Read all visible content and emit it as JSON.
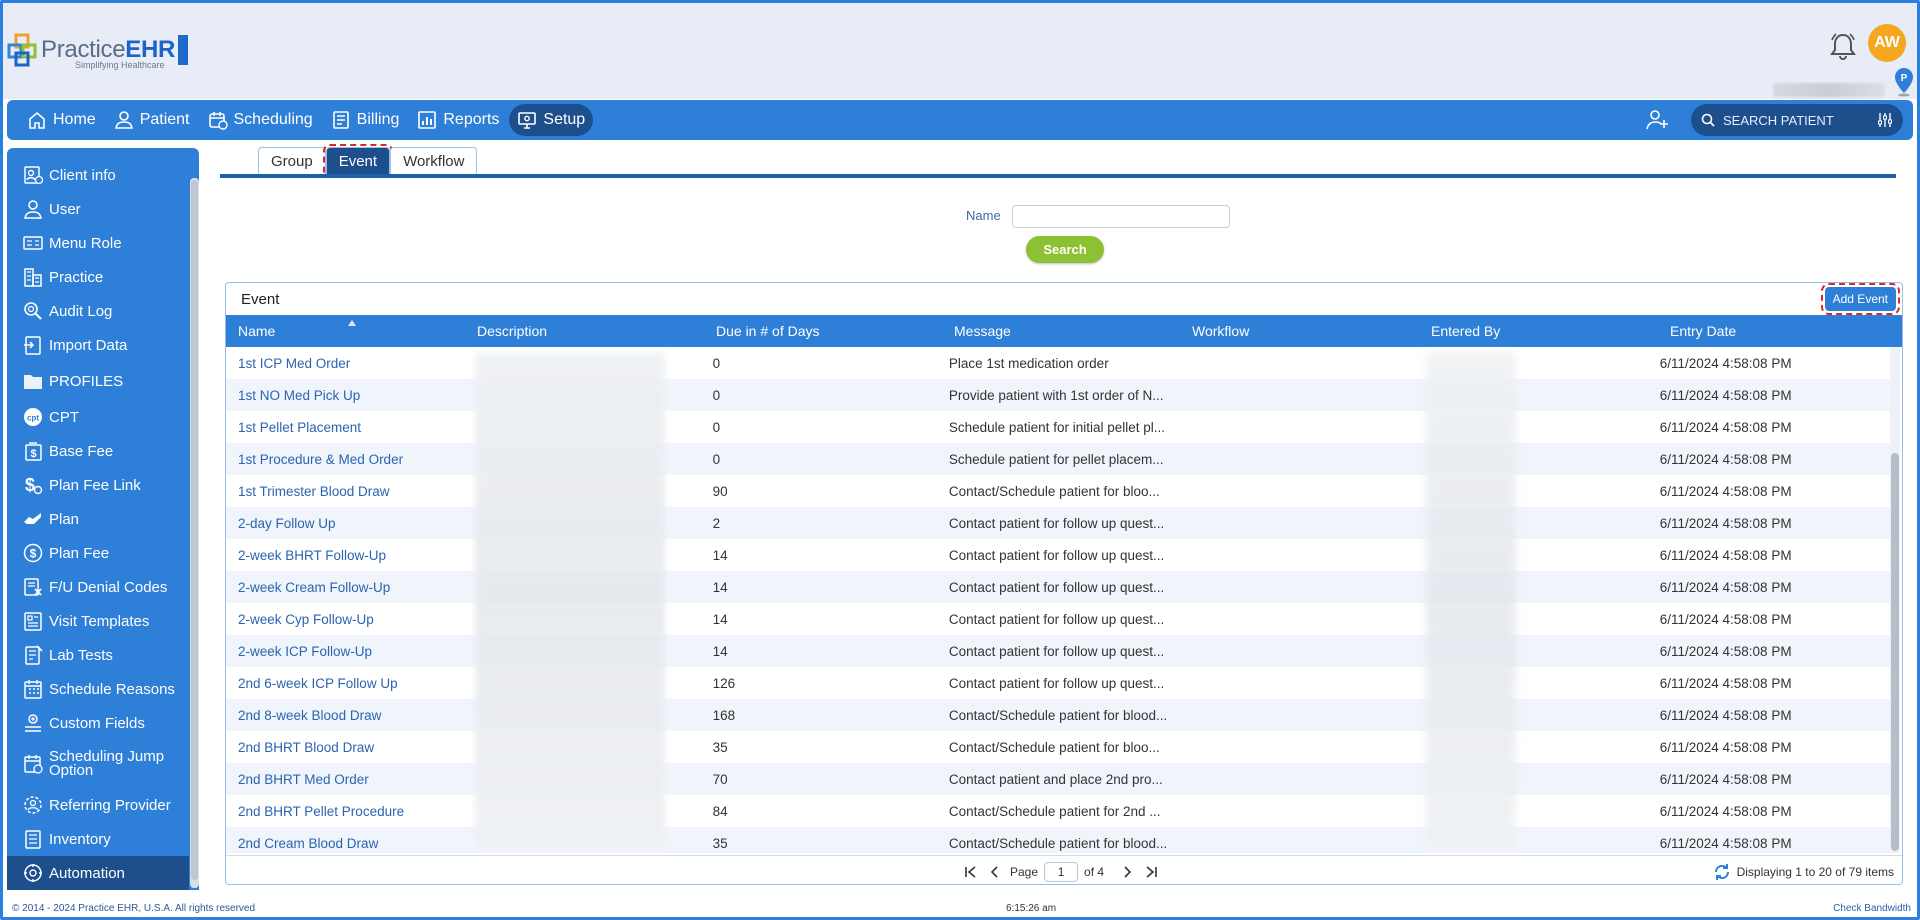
{
  "app": {
    "brand_light": "Practice",
    "brand_bold": "EHR",
    "tagline": "Simplifying Healthcare",
    "user_initials": "AW",
    "brand_color": "#2e7fd8",
    "accent_dark": "#1d4f8d",
    "avatar_color": "#f4a71f"
  },
  "nav": {
    "items": [
      {
        "label": "Home",
        "icon": "home-icon"
      },
      {
        "label": "Patient",
        "icon": "user-icon"
      },
      {
        "label": "Scheduling",
        "icon": "calendar-icon"
      },
      {
        "label": "Billing",
        "icon": "invoice-icon"
      },
      {
        "label": "Reports",
        "icon": "report-icon"
      },
      {
        "label": "Setup",
        "icon": "monitor-gear-icon",
        "active": true
      }
    ],
    "search_placeholder": "SEARCH PATIENT"
  },
  "sidebar": {
    "items": [
      {
        "label": "Client info",
        "icon": "client-info-icon"
      },
      {
        "label": "User",
        "icon": "user-icon"
      },
      {
        "label": "Menu Role",
        "icon": "menu-role-icon"
      },
      {
        "label": "Practice",
        "icon": "building-icon"
      },
      {
        "label": "Audit Log",
        "icon": "magnifier-icon"
      },
      {
        "label": "Import Data",
        "icon": "import-icon"
      },
      {
        "label": "PROFILES",
        "icon": "folder-icon",
        "section": true
      },
      {
        "label": "CPT",
        "icon": "cpt-icon"
      },
      {
        "label": "Base Fee",
        "icon": "dollar-doc-icon"
      },
      {
        "label": "Plan Fee Link",
        "icon": "dollar-link-icon"
      },
      {
        "label": "Plan",
        "icon": "hand-icon"
      },
      {
        "label": "Plan Fee",
        "icon": "dollar-circle-icon"
      },
      {
        "label": "F/U Denial Codes",
        "icon": "denial-icon"
      },
      {
        "label": "Visit Templates",
        "icon": "template-icon"
      },
      {
        "label": "Lab Tests",
        "icon": "lab-icon"
      },
      {
        "label": "Schedule Reasons",
        "icon": "calendar-grid-icon"
      },
      {
        "label": "Custom Fields",
        "icon": "custom-fields-icon"
      },
      {
        "label": "Scheduling Jump Option",
        "icon": "calendar-jump-icon",
        "tall": true
      },
      {
        "label": "Referring Provider",
        "icon": "gear-person-icon"
      },
      {
        "label": "Inventory",
        "icon": "inventory-icon"
      },
      {
        "label": "Automation",
        "icon": "automation-icon",
        "active": true
      }
    ]
  },
  "tabs": [
    {
      "label": "Group"
    },
    {
      "label": "Event",
      "active": true
    },
    {
      "label": "Workflow"
    }
  ],
  "filter": {
    "name_label": "Name",
    "name_value": "",
    "search_label": "Search"
  },
  "grid": {
    "title": "Event",
    "add_label": "Add Event",
    "columns": [
      "Name",
      "Description",
      "Due in # of Days",
      "Message",
      "Workflow",
      "Entered By",
      "Entry Date"
    ],
    "rows": [
      {
        "name": "1st ICP Med Order",
        "due": "0",
        "message": "Place 1st medication order",
        "date": "6/11/2024 4:58:08 PM"
      },
      {
        "name": "1st NO Med Pick Up",
        "due": "0",
        "message": "Provide patient with 1st order of N...",
        "date": "6/11/2024 4:58:08 PM"
      },
      {
        "name": "1st Pellet Placement",
        "due": "0",
        "message": "Schedule patient for initial pellet pl...",
        "date": "6/11/2024 4:58:08 PM"
      },
      {
        "name": "1st Procedure & Med Order",
        "due": "0",
        "message": "Schedule patient for pellet placem...",
        "date": "6/11/2024 4:58:08 PM"
      },
      {
        "name": "1st Trimester Blood Draw",
        "due": "90",
        "message": "Contact/Schedule patient for bloo...",
        "date": "6/11/2024 4:58:08 PM"
      },
      {
        "name": "2-day Follow Up",
        "due": "2",
        "message": "Contact patient for follow up quest...",
        "date": "6/11/2024 4:58:08 PM"
      },
      {
        "name": "2-week BHRT Follow-Up",
        "due": "14",
        "message": "Contact patient for follow up quest...",
        "date": "6/11/2024 4:58:08 PM"
      },
      {
        "name": "2-week Cream Follow-Up",
        "due": "14",
        "message": "Contact patient for follow up quest...",
        "date": "6/11/2024 4:58:08 PM"
      },
      {
        "name": "2-week Cyp Follow-Up",
        "due": "14",
        "message": "Contact patient for follow up quest...",
        "date": "6/11/2024 4:58:08 PM"
      },
      {
        "name": "2-week ICP Follow-Up",
        "due": "14",
        "message": "Contact patient for follow up quest...",
        "date": "6/11/2024 4:58:08 PM"
      },
      {
        "name": "2nd 6-week ICP Follow Up",
        "due": "126",
        "message": "Contact patient for follow up quest...",
        "date": "6/11/2024 4:58:08 PM"
      },
      {
        "name": "2nd 8-week Blood Draw",
        "due": "168",
        "message": "Contact/Schedule patient for blood...",
        "date": "6/11/2024 4:58:08 PM"
      },
      {
        "name": "2nd BHRT Blood Draw",
        "due": "35",
        "message": "Contact/Schedule patient for bloo...",
        "date": "6/11/2024 4:58:08 PM"
      },
      {
        "name": "2nd BHRT Med Order",
        "due": "70",
        "message": "Contact patient and place 2nd pro...",
        "date": "6/11/2024 4:58:08 PM"
      },
      {
        "name": "2nd BHRT Pellet Procedure",
        "due": "84",
        "message": "Contact/Schedule patient for 2nd ...",
        "date": "6/11/2024 4:58:08 PM"
      },
      {
        "name": "2nd Cream Blood Draw",
        "due": "35",
        "message": "Contact/Schedule patient for blood...",
        "date": "6/11/2024 4:58:08 PM"
      }
    ]
  },
  "pager": {
    "page_label": "Page",
    "page_value": "1",
    "of_label": "of 4",
    "info": "Displaying 1 to 20 of 79 items"
  },
  "footer": {
    "copyright": "© 2014 - 2024 Practice EHR, U.S.A. All rights reserved",
    "time": "6:15:26 am",
    "bandwidth": "Check Bandwidth"
  }
}
